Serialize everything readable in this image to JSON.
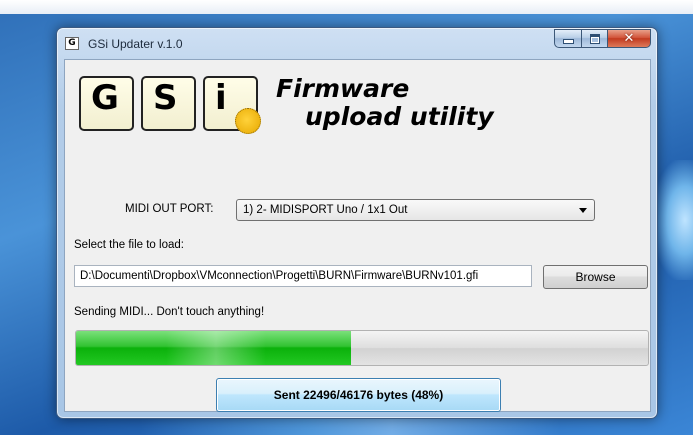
{
  "window": {
    "title": "GSi Updater v.1.0",
    "app_icon_letter": "G"
  },
  "logo": {
    "tile_g": "G",
    "tile_s": "S",
    "tile_i": "i",
    "heading_line1": "Firmware",
    "heading_line2": "upload utility"
  },
  "midi": {
    "label": "MIDI OUT PORT:",
    "selected": "1) 2- MIDISPORT Uno / 1x1 Out"
  },
  "file": {
    "label": "Select the file to load:",
    "path": "D:\\Documenti\\Dropbox\\VMconnection\\Progetti\\BURN\\Firmware\\BURNv101.gfi",
    "browse_label": "Browse"
  },
  "status": {
    "message": "Sending MIDI... Don't touch anything!",
    "progress_percent": 48,
    "button_label": "Sent 22496/46176 bytes (48%)"
  },
  "colors": {
    "progress_fill": "#16b816",
    "window_frame": "#b3cde9",
    "close_button": "#c23a1f"
  }
}
